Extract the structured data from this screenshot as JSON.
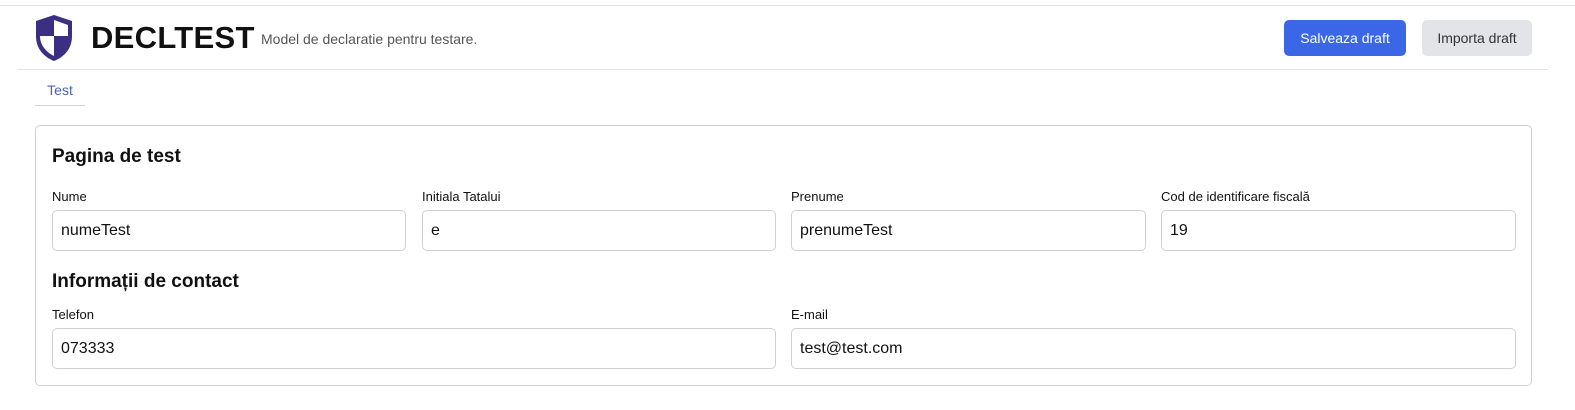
{
  "header": {
    "title": "DECLTEST",
    "subtitle": "Model de declaratie pentru testare.",
    "save_label": "Salveaza draft",
    "import_label": "Importa draft",
    "logo_icon": "shield-icon"
  },
  "tabs": [
    {
      "label": "Test"
    }
  ],
  "form": {
    "title": "Pagina de test",
    "fields": {
      "nume": {
        "label": "Nume",
        "value": "numeTest"
      },
      "initiala": {
        "label": "Initiala Tatalui",
        "value": "e"
      },
      "prenume": {
        "label": "Prenume",
        "value": "prenumeTest"
      },
      "cod": {
        "label": "Cod de identificare fiscală",
        "value": "19"
      }
    },
    "contact": {
      "title": "Informații de contact",
      "telefon": {
        "label": "Telefon",
        "value": "073333"
      },
      "email": {
        "label": "E-mail",
        "value": "test@test.com"
      }
    }
  },
  "colors": {
    "primary": "#3b67e6",
    "secondary": "#e3e4e8",
    "logo_dark": "#3a2f80",
    "tab_text": "#4a63b8"
  }
}
